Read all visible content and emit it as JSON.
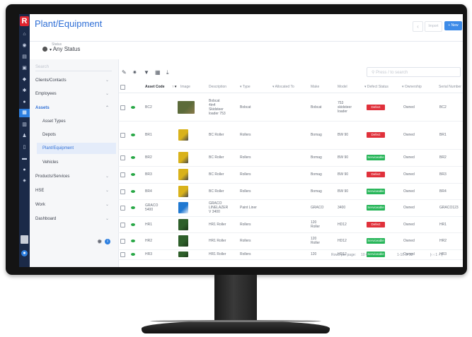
{
  "app": {
    "title": "Plant/Equipment",
    "logo_letter": "R"
  },
  "header": {
    "back_label": "‹",
    "import_label": "Import",
    "new_label": "+ New"
  },
  "filter": {
    "label": "Status",
    "value": "Any Status"
  },
  "nav": {
    "search_placeholder": "Search",
    "items": [
      {
        "label": "Clients/Contacts",
        "chev": "⌄"
      },
      {
        "label": "Employees",
        "chev": "⌄"
      },
      {
        "label": "Assets",
        "chev": "⌃"
      },
      {
        "label": "Asset Types"
      },
      {
        "label": "Depots"
      },
      {
        "label": "Plant/Equipment"
      },
      {
        "label": "Vehicles"
      },
      {
        "label": "Products/Services",
        "chev": "⌄"
      },
      {
        "label": "HSE",
        "chev": "⌄"
      },
      {
        "label": "Work",
        "chev": "⌄"
      },
      {
        "label": "Dashboard",
        "chev": "⌄"
      }
    ]
  },
  "toolbar": {
    "search_placeholder": "Press / to search"
  },
  "table": {
    "headers": [
      "Asset Code",
      "Image",
      "Description",
      "Type",
      "Allocated To",
      "Make",
      "Model",
      "Defect Status",
      "Ownership",
      "Serial Number"
    ],
    "rows": [
      {
        "code": "BC2",
        "desc": "Bobcat\n4in4\nSkidsteer\nloader 753",
        "type": "Bobcat",
        "make": "Bobcat",
        "model": "753\nskidsteer\nloader",
        "status": "Defect",
        "ownership": "Owned",
        "serial": "BC2"
      },
      {
        "code": "BR1",
        "desc": "BC Roller",
        "type": "Rollers",
        "make": "Bomag",
        "model": "BW 90",
        "status": "Defect",
        "ownership": "Owned",
        "serial": "BR1"
      },
      {
        "code": "BR2",
        "desc": "BC Roller",
        "type": "Rollers",
        "make": "Bomag",
        "model": "BW 90",
        "status": "Serviceable",
        "ownership": "Owned",
        "serial": "BR2"
      },
      {
        "code": "BR3",
        "desc": "BC Roller",
        "type": "Rollers",
        "make": "Bomag",
        "model": "BW 90",
        "status": "Defect",
        "ownership": "Owned",
        "serial": "BR3"
      },
      {
        "code": "BR4",
        "desc": "BC Roller",
        "type": "Rollers",
        "make": "Bomag",
        "model": "BW 90",
        "status": "Serviceable",
        "ownership": "Owned",
        "serial": "BR4"
      },
      {
        "code": "GRACO\n5400",
        "desc": "GRACO\nLINELAZER\nV 3400",
        "type": "Paint Liner",
        "make": "GRACO",
        "model": "3400",
        "status": "Serviceable",
        "ownership": "Owned",
        "serial": "GRACO123"
      },
      {
        "code": "HR1",
        "desc": "HR1 Roller",
        "type": "Rollers",
        "make": "120\nRoller",
        "model": "HD12",
        "status": "Defect",
        "ownership": "Owned",
        "serial": "HR1"
      },
      {
        "code": "HR2",
        "desc": "HR1 Roller",
        "type": "Rollers",
        "make": "120\nRoller",
        "model": "HD12",
        "status": "Serviceable",
        "ownership": "Owned",
        "serial": "HR2"
      },
      {
        "code": "HR3",
        "desc": "HR1 Roller",
        "type": "Rollers",
        "make": "120",
        "model": "HD12",
        "status": "Serviceable",
        "ownership": "Owned",
        "serial": "HR3"
      }
    ]
  },
  "pagination": {
    "rows_per_page_label": "Rows per page:",
    "rows_per_page": "10",
    "range": "1-10 of 32",
    "controls": "|‹  ‹  1  ›  ›|"
  },
  "colors": {
    "accent": "#2d7fe0",
    "defect": "#e0313b",
    "serviceable": "#28b65a",
    "rail": "#1b2a48",
    "logo": "#e0232e"
  }
}
